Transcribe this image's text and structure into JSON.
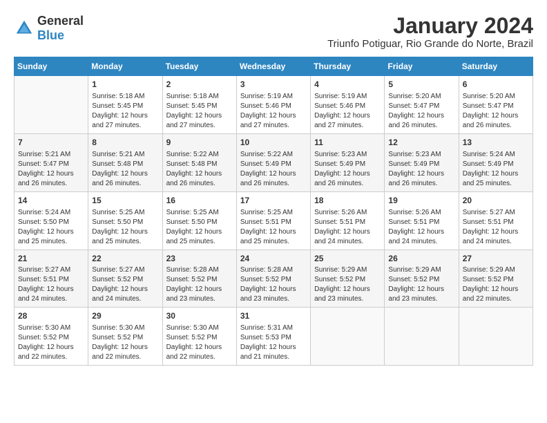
{
  "logo": {
    "text_general": "General",
    "text_blue": "Blue"
  },
  "title": "January 2024",
  "subtitle": "Triunfo Potiguar, Rio Grande do Norte, Brazil",
  "days_of_week": [
    "Sunday",
    "Monday",
    "Tuesday",
    "Wednesday",
    "Thursday",
    "Friday",
    "Saturday"
  ],
  "weeks": [
    [
      {
        "day": "",
        "info": ""
      },
      {
        "day": "1",
        "info": "Sunrise: 5:18 AM\nSunset: 5:45 PM\nDaylight: 12 hours\nand 27 minutes."
      },
      {
        "day": "2",
        "info": "Sunrise: 5:18 AM\nSunset: 5:45 PM\nDaylight: 12 hours\nand 27 minutes."
      },
      {
        "day": "3",
        "info": "Sunrise: 5:19 AM\nSunset: 5:46 PM\nDaylight: 12 hours\nand 27 minutes."
      },
      {
        "day": "4",
        "info": "Sunrise: 5:19 AM\nSunset: 5:46 PM\nDaylight: 12 hours\nand 27 minutes."
      },
      {
        "day": "5",
        "info": "Sunrise: 5:20 AM\nSunset: 5:47 PM\nDaylight: 12 hours\nand 26 minutes."
      },
      {
        "day": "6",
        "info": "Sunrise: 5:20 AM\nSunset: 5:47 PM\nDaylight: 12 hours\nand 26 minutes."
      }
    ],
    [
      {
        "day": "7",
        "info": "Sunrise: 5:21 AM\nSunset: 5:47 PM\nDaylight: 12 hours\nand 26 minutes."
      },
      {
        "day": "8",
        "info": "Sunrise: 5:21 AM\nSunset: 5:48 PM\nDaylight: 12 hours\nand 26 minutes."
      },
      {
        "day": "9",
        "info": "Sunrise: 5:22 AM\nSunset: 5:48 PM\nDaylight: 12 hours\nand 26 minutes."
      },
      {
        "day": "10",
        "info": "Sunrise: 5:22 AM\nSunset: 5:49 PM\nDaylight: 12 hours\nand 26 minutes."
      },
      {
        "day": "11",
        "info": "Sunrise: 5:23 AM\nSunset: 5:49 PM\nDaylight: 12 hours\nand 26 minutes."
      },
      {
        "day": "12",
        "info": "Sunrise: 5:23 AM\nSunset: 5:49 PM\nDaylight: 12 hours\nand 26 minutes."
      },
      {
        "day": "13",
        "info": "Sunrise: 5:24 AM\nSunset: 5:49 PM\nDaylight: 12 hours\nand 25 minutes."
      }
    ],
    [
      {
        "day": "14",
        "info": "Sunrise: 5:24 AM\nSunset: 5:50 PM\nDaylight: 12 hours\nand 25 minutes."
      },
      {
        "day": "15",
        "info": "Sunrise: 5:25 AM\nSunset: 5:50 PM\nDaylight: 12 hours\nand 25 minutes."
      },
      {
        "day": "16",
        "info": "Sunrise: 5:25 AM\nSunset: 5:50 PM\nDaylight: 12 hours\nand 25 minutes."
      },
      {
        "day": "17",
        "info": "Sunrise: 5:25 AM\nSunset: 5:51 PM\nDaylight: 12 hours\nand 25 minutes."
      },
      {
        "day": "18",
        "info": "Sunrise: 5:26 AM\nSunset: 5:51 PM\nDaylight: 12 hours\nand 24 minutes."
      },
      {
        "day": "19",
        "info": "Sunrise: 5:26 AM\nSunset: 5:51 PM\nDaylight: 12 hours\nand 24 minutes."
      },
      {
        "day": "20",
        "info": "Sunrise: 5:27 AM\nSunset: 5:51 PM\nDaylight: 12 hours\nand 24 minutes."
      }
    ],
    [
      {
        "day": "21",
        "info": "Sunrise: 5:27 AM\nSunset: 5:51 PM\nDaylight: 12 hours\nand 24 minutes."
      },
      {
        "day": "22",
        "info": "Sunrise: 5:27 AM\nSunset: 5:52 PM\nDaylight: 12 hours\nand 24 minutes."
      },
      {
        "day": "23",
        "info": "Sunrise: 5:28 AM\nSunset: 5:52 PM\nDaylight: 12 hours\nand 23 minutes."
      },
      {
        "day": "24",
        "info": "Sunrise: 5:28 AM\nSunset: 5:52 PM\nDaylight: 12 hours\nand 23 minutes."
      },
      {
        "day": "25",
        "info": "Sunrise: 5:29 AM\nSunset: 5:52 PM\nDaylight: 12 hours\nand 23 minutes."
      },
      {
        "day": "26",
        "info": "Sunrise: 5:29 AM\nSunset: 5:52 PM\nDaylight: 12 hours\nand 23 minutes."
      },
      {
        "day": "27",
        "info": "Sunrise: 5:29 AM\nSunset: 5:52 PM\nDaylight: 12 hours\nand 22 minutes."
      }
    ],
    [
      {
        "day": "28",
        "info": "Sunrise: 5:30 AM\nSunset: 5:52 PM\nDaylight: 12 hours\nand 22 minutes."
      },
      {
        "day": "29",
        "info": "Sunrise: 5:30 AM\nSunset: 5:52 PM\nDaylight: 12 hours\nand 22 minutes."
      },
      {
        "day": "30",
        "info": "Sunrise: 5:30 AM\nSunset: 5:52 PM\nDaylight: 12 hours\nand 22 minutes."
      },
      {
        "day": "31",
        "info": "Sunrise: 5:31 AM\nSunset: 5:53 PM\nDaylight: 12 hours\nand 21 minutes."
      },
      {
        "day": "",
        "info": ""
      },
      {
        "day": "",
        "info": ""
      },
      {
        "day": "",
        "info": ""
      }
    ]
  ]
}
